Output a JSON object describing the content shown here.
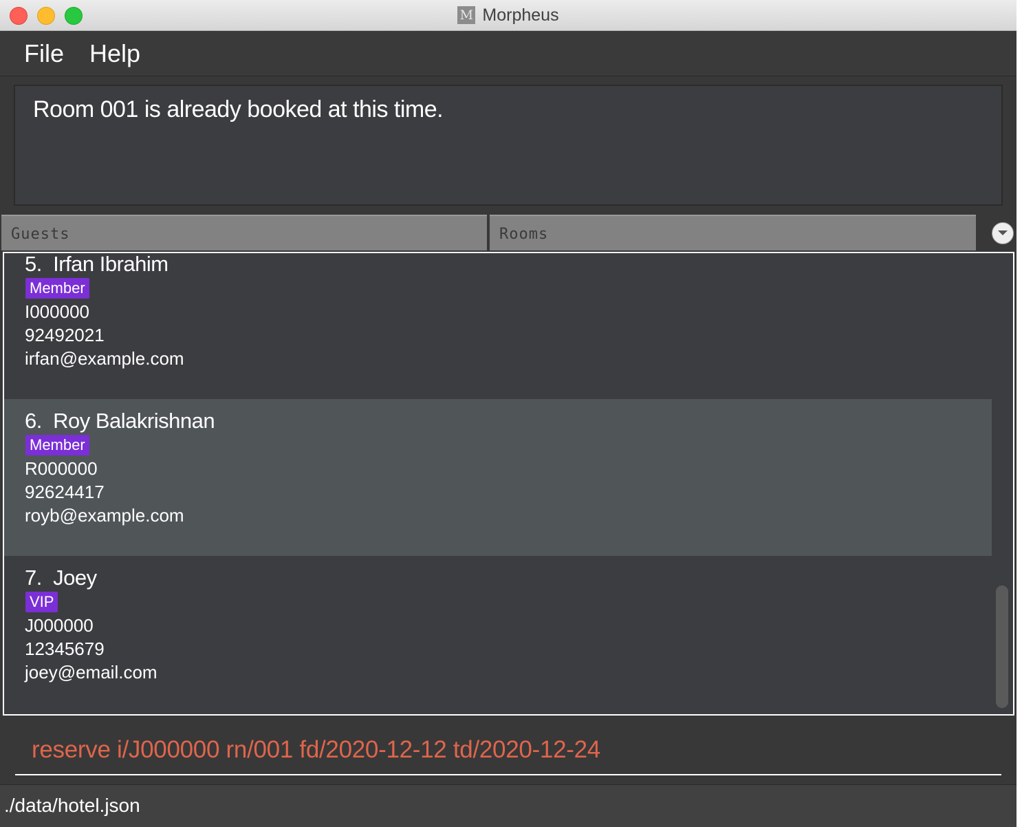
{
  "window": {
    "title": "Morpheus",
    "app_icon_letter": "M"
  },
  "menu": {
    "file": "File",
    "help": "Help"
  },
  "result_display": {
    "text": "Room 001 is already booked at this time."
  },
  "tabs": [
    {
      "label": "Guests",
      "selected": true
    },
    {
      "label": "Rooms",
      "selected": false
    }
  ],
  "guests": [
    {
      "index": "5.",
      "name": "Irfan Ibrahim",
      "tag": "Member",
      "id": "I000000",
      "phone": "92492021",
      "email": "irfan@example.com"
    },
    {
      "index": "6.",
      "name": "Roy Balakrishnan",
      "tag": "Member",
      "id": "R000000",
      "phone": "92624417",
      "email": "royb@example.com"
    },
    {
      "index": "7.",
      "name": "Joey",
      "tag": "VIP",
      "id": "J000000",
      "phone": "12345679",
      "email": "joey@email.com"
    }
  ],
  "command_box": {
    "value": "reserve i/J000000 rn/001 fd/2020-12-12 td/2020-12-24"
  },
  "status_bar": {
    "path": "./data/hotel.json"
  },
  "colors": {
    "background": "#383838",
    "card_alt": "#505558",
    "tag": "#7b2fd6",
    "command_error_text": "#e0654c"
  }
}
